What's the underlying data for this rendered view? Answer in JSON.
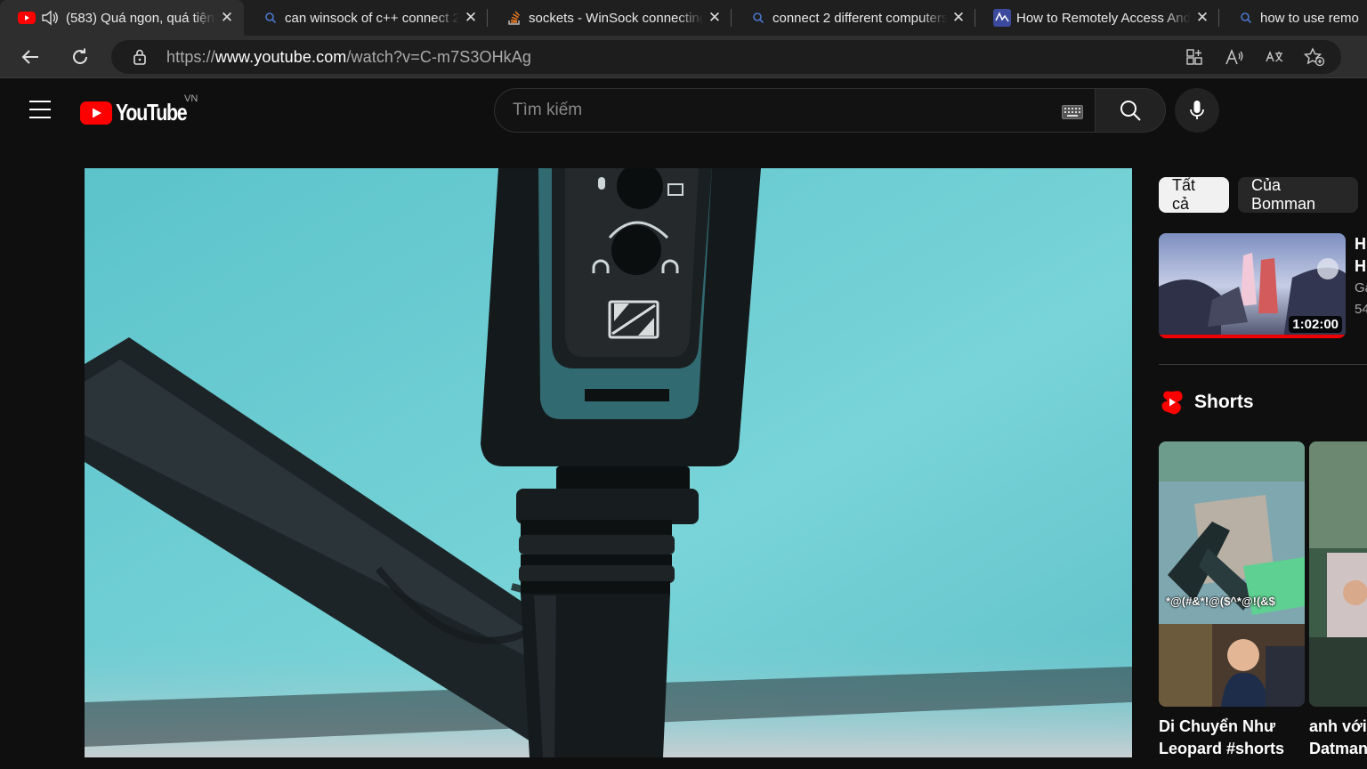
{
  "browser": {
    "tabs": [
      {
        "title": "(583) Quá ngon, quá tiện",
        "icon": "youtube-icon",
        "active": true,
        "audio": true
      },
      {
        "title": "can winsock of c++ connect 2",
        "icon": "search-icon",
        "active": false
      },
      {
        "title": "sockets - WinSock connecting",
        "icon": "stackoverflow-icon",
        "active": false
      },
      {
        "title": "connect 2 different computers",
        "icon": "search-icon",
        "active": false
      },
      {
        "title": "How to Remotely Access Andro",
        "icon": "site-icon",
        "active": false
      },
      {
        "title": "how to use remo",
        "icon": "search-icon",
        "active": false
      }
    ],
    "close_glyph": "✕",
    "url": {
      "scheme": "https://",
      "host": "www.youtube.com",
      "path": "/watch?v=C-m7S3OHkAg"
    }
  },
  "youtube": {
    "logo_text": "YouTube",
    "country_code": "VN",
    "search_placeholder": "Tìm kiếm",
    "chips": [
      "Tất cả",
      "Của Bomman"
    ],
    "recommendation": {
      "duration": "1:02:00",
      "title_lines": [
        "H",
        "H"
      ],
      "channel": "Ga",
      "views": "54"
    },
    "shorts_heading": "Shorts",
    "shorts": [
      {
        "title_lines": [
          "Di Chuyển Như",
          "Leopard #shorts"
        ],
        "overlay_text": "*@(#&*!@($^*@!(&$"
      },
      {
        "title_lines": [
          "anh với",
          "Datmani"
        ]
      }
    ]
  },
  "colors": {
    "accent_red": "#ff0000",
    "background": "#0f0f0f",
    "video_teal": "#6fc9cf"
  }
}
